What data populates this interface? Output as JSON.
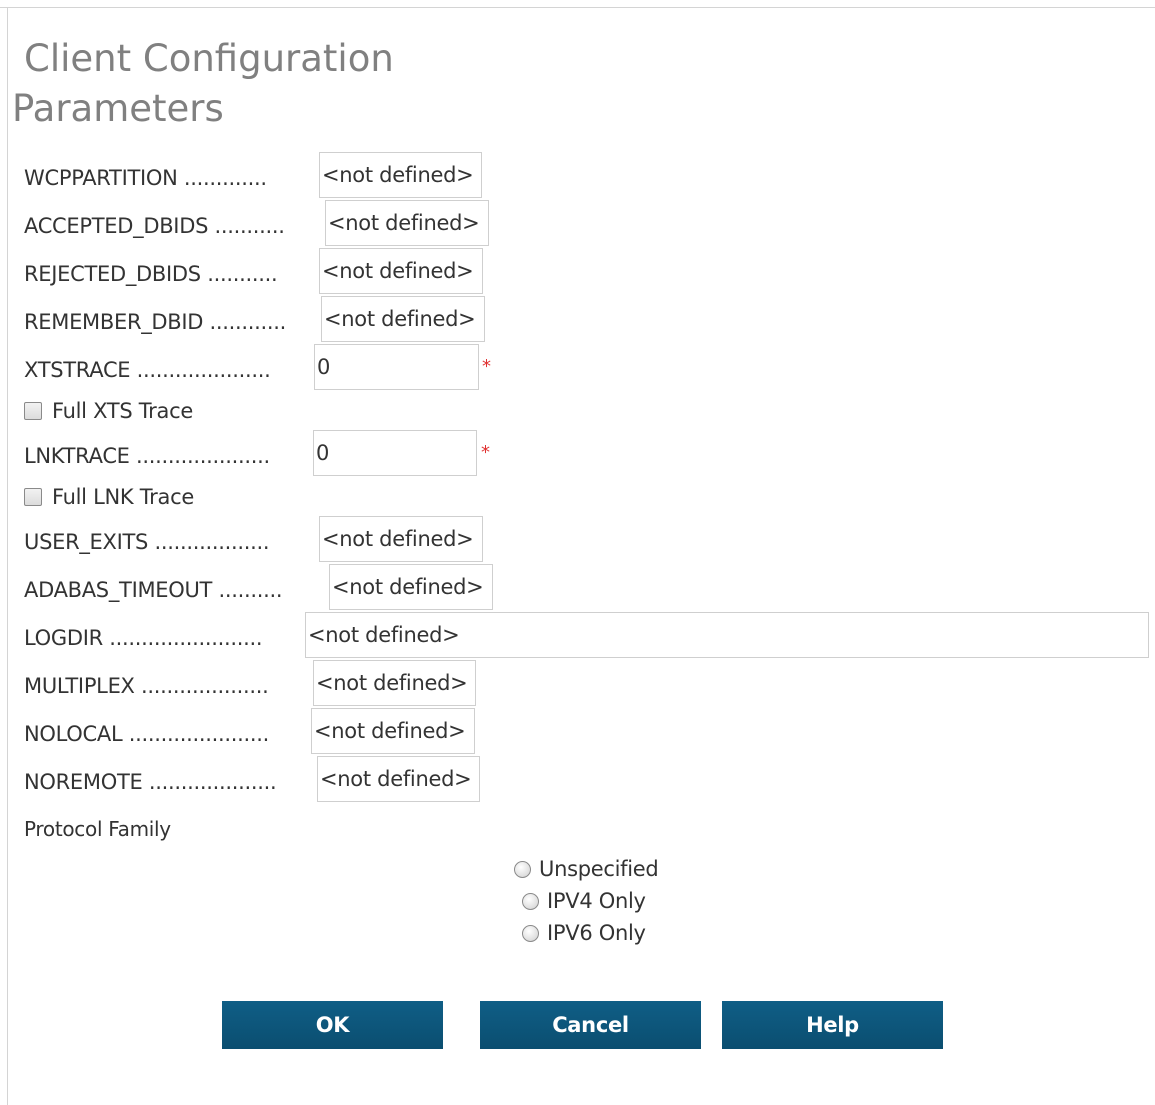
{
  "title": {
    "line1": "Client Configuration",
    "line2": "Parameters"
  },
  "fields": [
    {
      "label": "WCPPARTITION .............",
      "value": "<not defined>"
    },
    {
      "label": "ACCEPTED_DBIDS ...........",
      "value": "<not defined>"
    },
    {
      "label": "REJECTED_DBIDS ...........",
      "value": "<not defined>"
    },
    {
      "label": "REMEMBER_DBID ............",
      "value": "<not defined>"
    },
    {
      "label": "XTSTRACE .....................",
      "value": "0",
      "required_mark": "*"
    },
    {
      "label": "LNKTRACE .....................",
      "value": "0",
      "required_mark": "*"
    },
    {
      "label": "USER_EXITS ..................",
      "value": "<not defined>"
    },
    {
      "label": "ADABAS_TIMEOUT ..........",
      "value": "<not defined>"
    },
    {
      "label": "LOGDIR ........................",
      "value": "<not defined>"
    },
    {
      "label": "MULTIPLEX ....................",
      "value": "<not defined>"
    },
    {
      "label": "NOLOCAL ......................",
      "value": "<not defined>"
    },
    {
      "label": "NOREMOTE ....................",
      "value": "<not defined>"
    }
  ],
  "checkboxes": {
    "full_xts": {
      "label": "Full XTS Trace",
      "checked": false
    },
    "full_lnk": {
      "label": "Full LNK Trace",
      "checked": false
    }
  },
  "protocol": {
    "label": "Protocol Family",
    "options": [
      "Unspecified",
      "IPV4 Only",
      "IPV6 Only"
    ]
  },
  "buttons": {
    "ok": "OK",
    "cancel": "Cancel",
    "help": "Help"
  },
  "colors": {
    "button_bg": "#0b5475",
    "required": "#e03030",
    "title": "#808080"
  }
}
